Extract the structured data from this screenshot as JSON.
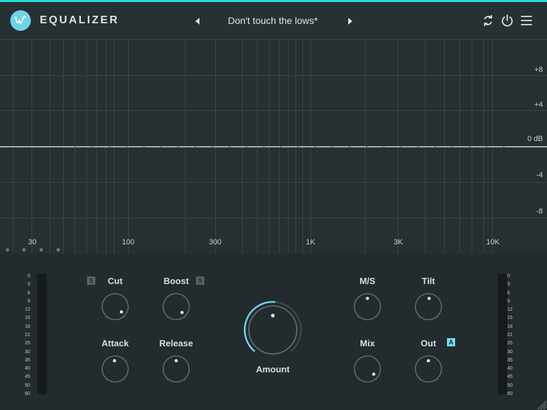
{
  "header": {
    "logo_letter": "w",
    "title": "EQUALIZER",
    "preset_name": "Don't touch the lows*",
    "icons": [
      "logo-icon",
      "preset-prev-icon",
      "preset-next-icon",
      "sync-icon",
      "power-icon",
      "menu-icon"
    ]
  },
  "eq": {
    "db_labels": [
      "+8",
      "+4",
      "0 dB",
      "-4",
      "-8"
    ],
    "freq_labels": [
      "30",
      "100",
      "300",
      "1K",
      "3K",
      "10K"
    ]
  },
  "meters": {
    "scale": [
      "0",
      "3",
      "6",
      "9",
      "12",
      "15",
      "18",
      "21",
      "25",
      "30",
      "35",
      "40",
      "45",
      "50",
      "60"
    ]
  },
  "knobs": {
    "cut": {
      "label": "Cut",
      "tag": "S"
    },
    "boost": {
      "label": "Boost",
      "tag": "S"
    },
    "attack": {
      "label": "Attack"
    },
    "release": {
      "label": "Release"
    },
    "amount": {
      "label": "Amount"
    },
    "ms": {
      "label": "M/S"
    },
    "tilt": {
      "label": "Tilt"
    },
    "mix": {
      "label": "Mix"
    },
    "out": {
      "label": "Out",
      "tag": "A"
    }
  },
  "colors": {
    "accent": "#6fd3e6",
    "top_line": "#2ad8d8",
    "eq_background": "#263033",
    "panel_background": "#232b2e"
  }
}
